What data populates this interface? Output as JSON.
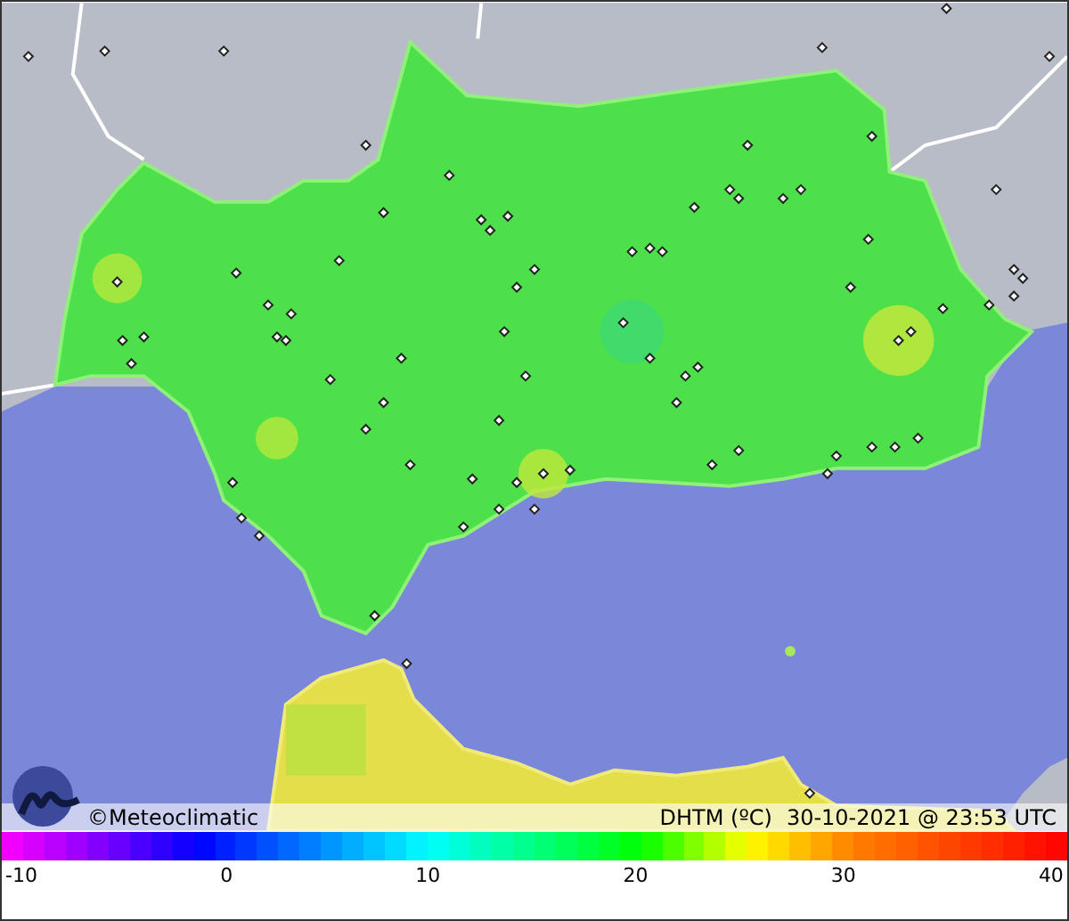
{
  "map": {
    "credit": "©Meteoclimatic",
    "variable": "DHTM (ºC)",
    "timestamp": "30-10-2021 @ 23:53 UTC"
  },
  "legend": {
    "ticks": [
      "-10",
      "0",
      "10",
      "20",
      "30",
      "40"
    ]
  }
}
